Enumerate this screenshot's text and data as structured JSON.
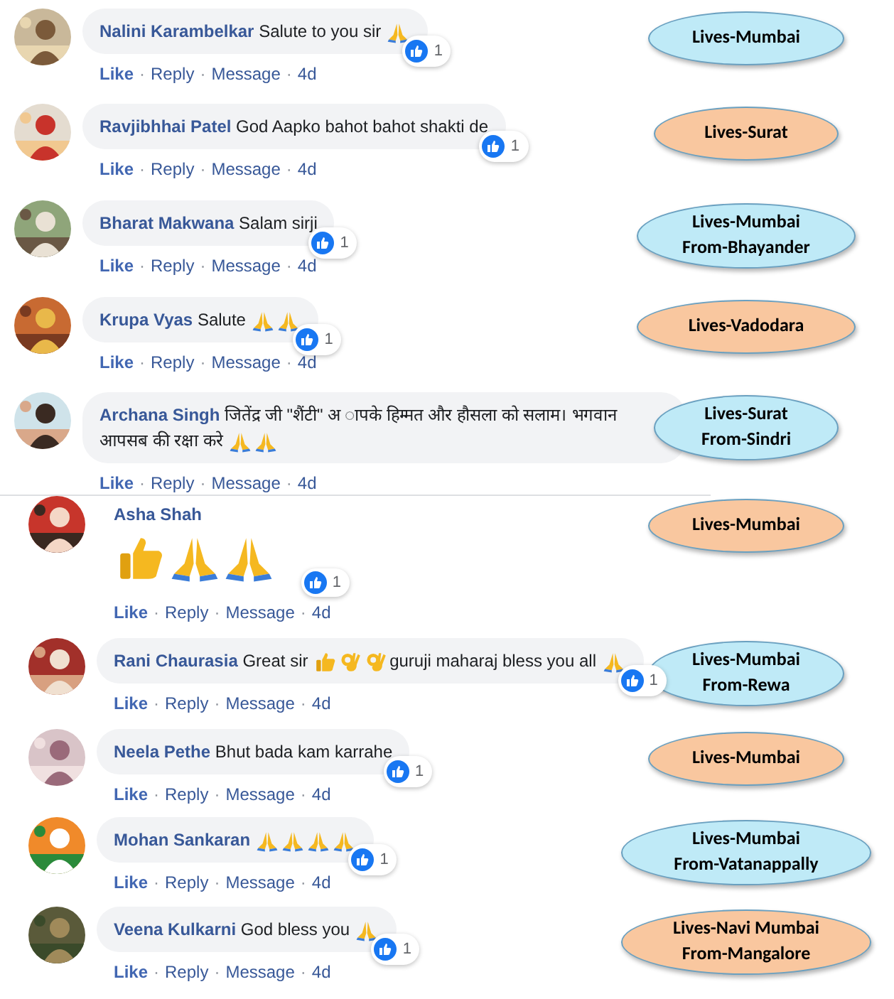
{
  "separator": "·",
  "sections": [
    {
      "comments": [
        {
          "kind": "bubble",
          "author": "Nalini Karambelkar",
          "parts": [
            {
              "kind": "text",
              "text": "Salute to you sir"
            },
            {
              "kind": "pray"
            }
          ],
          "reactions": "1",
          "actions": [
            "Like",
            "Reply",
            "Message"
          ],
          "time": "4d",
          "note": {
            "lines": [
              "Lives-Mumbai"
            ],
            "color": "#bfeaf7"
          }
        },
        {
          "kind": "bubble",
          "author": "Ravjibhhai Patel",
          "parts": [
            {
              "kind": "text",
              "text": "God Aapko bahot bahot shakti de"
            }
          ],
          "reactions": "1",
          "actions": [
            "Like",
            "Reply",
            "Message"
          ],
          "time": "4d",
          "note": {
            "lines": [
              "Lives-Surat"
            ],
            "color": "#f9c79f"
          }
        },
        {
          "kind": "bubble",
          "author": "Bharat Makwana",
          "parts": [
            {
              "kind": "text",
              "text": "Salam sirji"
            }
          ],
          "reactions": "1",
          "actions": [
            "Like",
            "Reply",
            "Message"
          ],
          "time": "4d",
          "note": {
            "lines": [
              "Lives-Mumbai",
              "From-Bhayander"
            ],
            "color": "#bfeaf7"
          }
        },
        {
          "kind": "bubble",
          "author": "Krupa Vyas",
          "parts": [
            {
              "kind": "text",
              "text": "Salute"
            },
            {
              "kind": "pray"
            },
            {
              "kind": "pray"
            }
          ],
          "reactions": "1",
          "actions": [
            "Like",
            "Reply",
            "Message"
          ],
          "time": "4d",
          "note": {
            "lines": [
              "Lives-Vadodara"
            ],
            "color": "#f9c79f"
          }
        },
        {
          "kind": "bubble",
          "author": "Archana Singh",
          "parts": [
            {
              "kind": "text",
              "text": "जितेंद्र जी \"शैंटी\" अ ापके हिम्मत और हौसला को सलाम। भगवान आपसब की रक्षा करे"
            },
            {
              "kind": "pray"
            },
            {
              "kind": "pray"
            }
          ],
          "actions": [
            "Like",
            "Reply",
            "Message"
          ],
          "time": "4d",
          "note": {
            "lines": [
              "Lives-Surat",
              "From-Sindri"
            ],
            "color": "#bfeaf7"
          }
        }
      ]
    },
    {
      "comments": [
        {
          "kind": "jumbo",
          "author": "Asha Shah",
          "parts": [
            {
              "kind": "thumbs"
            },
            {
              "kind": "pray"
            },
            {
              "kind": "pray"
            }
          ],
          "reactions": "1",
          "actions": [
            "Like",
            "Reply",
            "Message"
          ],
          "time": "4d",
          "note": {
            "lines": [
              "Lives-Mumbai"
            ],
            "color": "#f9c79f"
          }
        },
        {
          "kind": "bubble",
          "author": "Rani Chaurasia",
          "parts": [
            {
              "kind": "text",
              "text": "Great sir"
            },
            {
              "kind": "thumbs"
            },
            {
              "kind": "ok"
            },
            {
              "kind": "ok"
            },
            {
              "kind": "text",
              "text": "guruji maharaj bless you all"
            },
            {
              "kind": "pray"
            }
          ],
          "reactions": "1",
          "actions": [
            "Like",
            "Reply",
            "Message"
          ],
          "time": "4d",
          "note": {
            "lines": [
              "Lives-Mumbai",
              "From-Rewa"
            ],
            "color": "#bfeaf7"
          }
        },
        {
          "kind": "bubble",
          "author": "Neela Pethe",
          "parts": [
            {
              "kind": "text",
              "text": "Bhut bada kam karrahe"
            }
          ],
          "reactions": "1",
          "actions": [
            "Like",
            "Reply",
            "Message"
          ],
          "time": "4d",
          "note": {
            "lines": [
              "Lives-Mumbai"
            ],
            "color": "#f9c79f"
          }
        },
        {
          "kind": "bubble",
          "author": "Mohan Sankaran",
          "parts": [
            {
              "kind": "pray"
            },
            {
              "kind": "pray"
            },
            {
              "kind": "pray"
            },
            {
              "kind": "pray"
            }
          ],
          "reactions": "1",
          "actions": [
            "Like",
            "Reply",
            "Message"
          ],
          "time": "4d",
          "note": {
            "lines": [
              "Lives-Mumbai",
              "From-Vatanappally"
            ],
            "color": "#bfeaf7"
          }
        },
        {
          "kind": "bubble",
          "author": "Veena Kulkarni",
          "parts": [
            {
              "kind": "text",
              "text": "God bless you"
            },
            {
              "kind": "pray"
            }
          ],
          "reactions": "1",
          "actions": [
            "Like",
            "Reply",
            "Message"
          ],
          "time": "4d",
          "note": {
            "lines": [
              "Lives-Navi Mumbai",
              "From-Mangalore"
            ],
            "color": "#f9c79f"
          }
        }
      ]
    }
  ]
}
